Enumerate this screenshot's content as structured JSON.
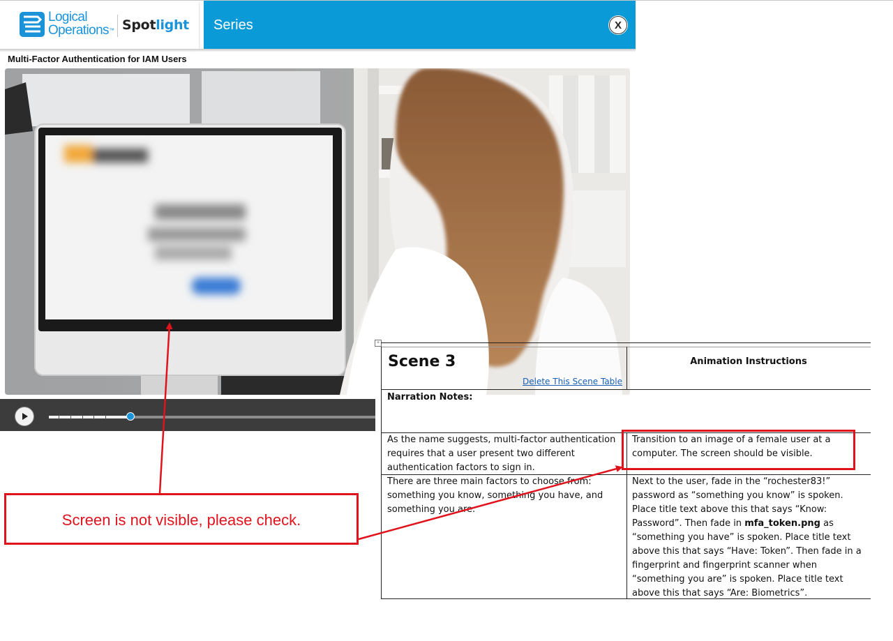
{
  "header": {
    "logo_line1": "Logical",
    "logo_line2": "Operations",
    "logo_tm": "™",
    "spotlight_a": "Spot",
    "spotlight_b": "light",
    "section_title": "Series",
    "close_label": "X"
  },
  "video": {
    "title": "Multi-Factor Authentication for IAM Users",
    "progress_fraction": 0.25
  },
  "scene_table": {
    "scene_title": "Scene 3",
    "delete_link": "Delete This Scene Table",
    "animation_header": "Animation Instructions",
    "narration_header": "Narration Notes:",
    "rows": [
      {
        "narration_lines": [
          "As the name suggests, multi-factor authentication",
          "requires that a user present two different",
          "authentication factors to sign in."
        ],
        "animation_lines": [
          "Transition to an image of a female user at a",
          "computer. The screen should be visible."
        ]
      },
      {
        "narration_lines": [
          "There are three main factors to choose from:",
          "something you know, something you have, and",
          "something you are."
        ],
        "animation_lines": [
          "Next to the user, fade in the “rochester83!”",
          "password as “something you know” is spoken.",
          "Place title text above this that says “Know:",
          "Password”. Then fade in ",
          "“something you have” is spoken.  Place title text",
          "above this that says “Have: Token”. Then fade in a",
          "fingerprint and fingerprint scanner when",
          "“something you are” is spoken.  Place title text",
          "above this that says “Are: Biometrics”."
        ],
        "bold_filename": "mfa_token.png",
        "after_bold": " as"
      }
    ]
  },
  "annotation": {
    "callout_text": "Screen is not visible, please check.",
    "color": "#e0131c"
  },
  "colors": {
    "brand_blue": "#1a93d9",
    "header_bar": "#0a9ad8",
    "annotation_red": "#e0131c"
  }
}
